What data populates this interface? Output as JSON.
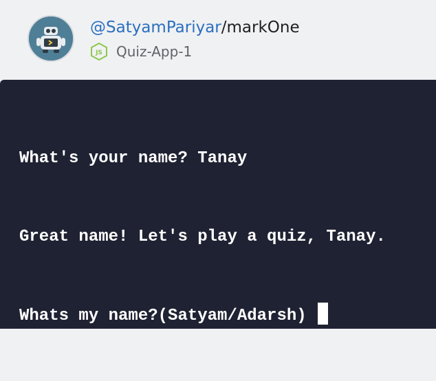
{
  "header": {
    "avatar_icon": "robot-avatar-icon",
    "repo": {
      "user": "@SatyamPariyar",
      "separator": "/",
      "name": "markOne"
    },
    "repl": {
      "language_icon": "nodejs-icon",
      "name": "Quiz-App-1"
    }
  },
  "terminal": {
    "lines": [
      "What's your name? Tanay",
      "Great name! Let's play a quiz, Tanay.",
      "Whats my name?(Satyam/Adarsh)"
    ]
  },
  "colors": {
    "user_link": "#2b6fbf",
    "terminal_bg": "#1f2232",
    "terminal_text": "#ffffff",
    "header_bg": "#f0f1f3",
    "node_green": "#8cc84b"
  }
}
